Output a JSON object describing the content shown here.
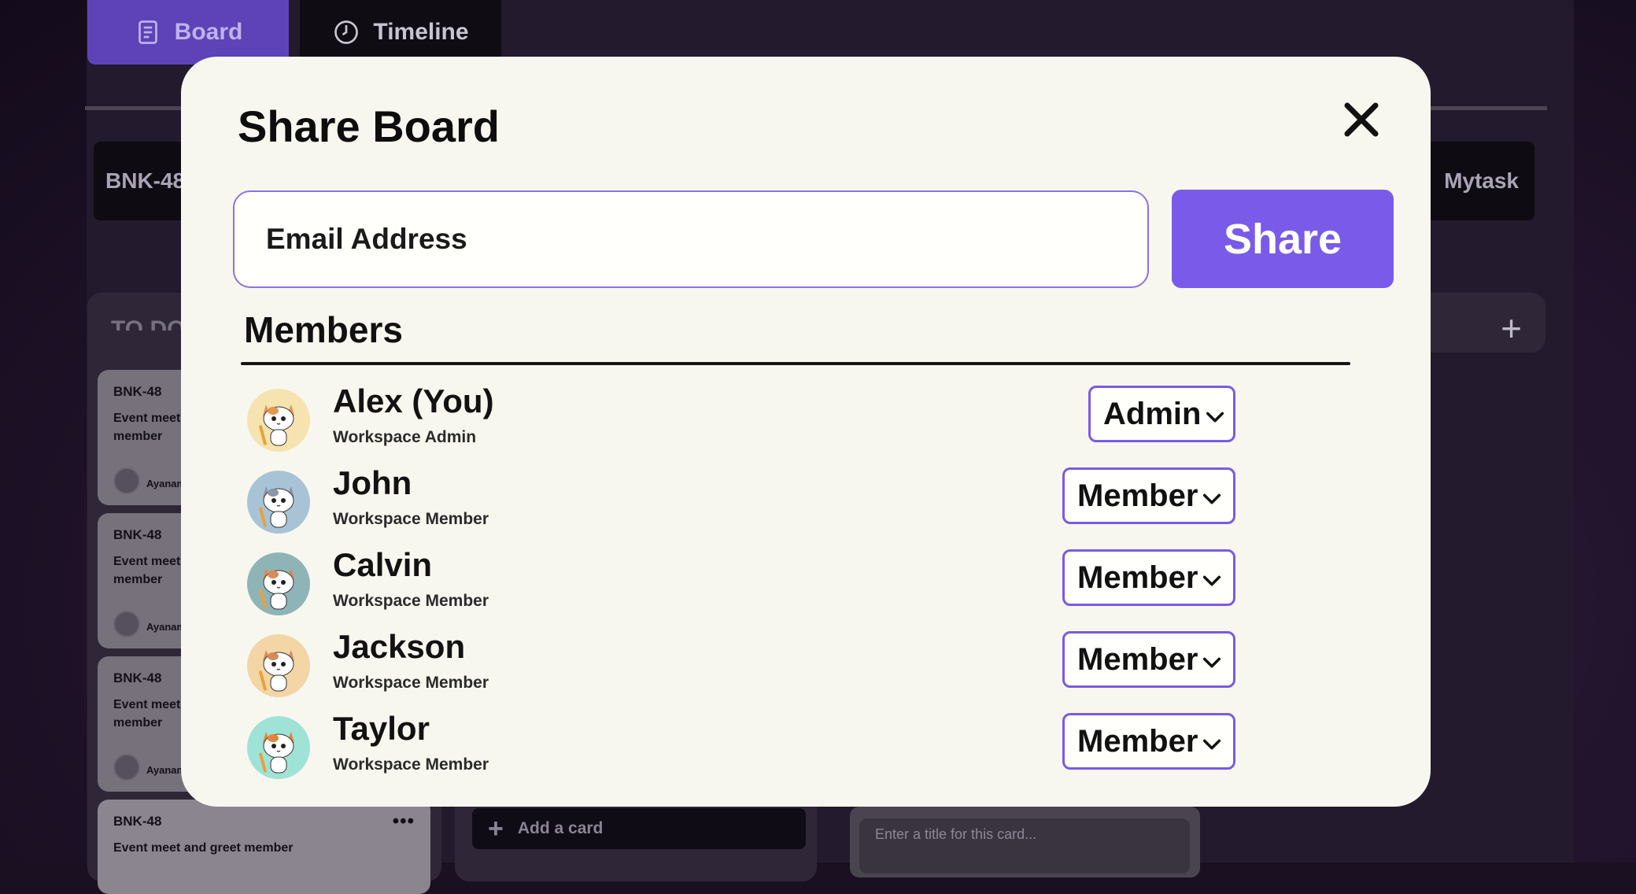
{
  "tabs": [
    {
      "label": "Board",
      "icon": "document-icon"
    },
    {
      "label": "Timeline",
      "icon": "clock-icon"
    }
  ],
  "background": {
    "key_left": "BNK-48",
    "key_right": "Mytask",
    "column_title": "TO DO",
    "cards": [
      {
        "id": "BNK-48",
        "title": "Event meet and greet member",
        "assignee": "Ayanami"
      },
      {
        "id": "BNK-48",
        "title": "Event meet and greet member",
        "assignee": "Ayanami"
      },
      {
        "id": "BNK-48",
        "title": "Event meet and greet member",
        "assignee": "Ayanami"
      },
      {
        "id": "BNK-48",
        "title": "Event meet and greet member",
        "assignee": ""
      }
    ],
    "add_card_label": "Add a card",
    "new_card_placeholder": "Enter a title for this card..."
  },
  "modal": {
    "title": "Share Board",
    "email_placeholder": "Email Address",
    "share_label": "Share",
    "members_heading": "Members",
    "members": [
      {
        "name": "Alex (You)",
        "role_desc": "Workspace Admin",
        "role": "Admin",
        "avatar_color": "#f6e3b0",
        "cat_color": "#e8964f"
      },
      {
        "name": "John",
        "role_desc": "Workspace Member",
        "role": "Member",
        "avatar_color": "#a9c3d6",
        "cat_color": "#8a95a8"
      },
      {
        "name": "Calvin",
        "role_desc": "Workspace Member",
        "role": "Member",
        "avatar_color": "#8fb4b8",
        "cat_color": "#d98a55"
      },
      {
        "name": "Jackson",
        "role_desc": "Workspace Member",
        "role": "Member",
        "avatar_color": "#f3d5a6",
        "cat_color": "#d68a5c"
      },
      {
        "name": "Taylor",
        "role_desc": "Workspace Member",
        "role": "Member",
        "avatar_color": "#9fe3d6",
        "cat_color": "#e5843a"
      }
    ]
  },
  "colors": {
    "accent": "#7a5ae8",
    "modal_bg": "#f8f7ef"
  }
}
